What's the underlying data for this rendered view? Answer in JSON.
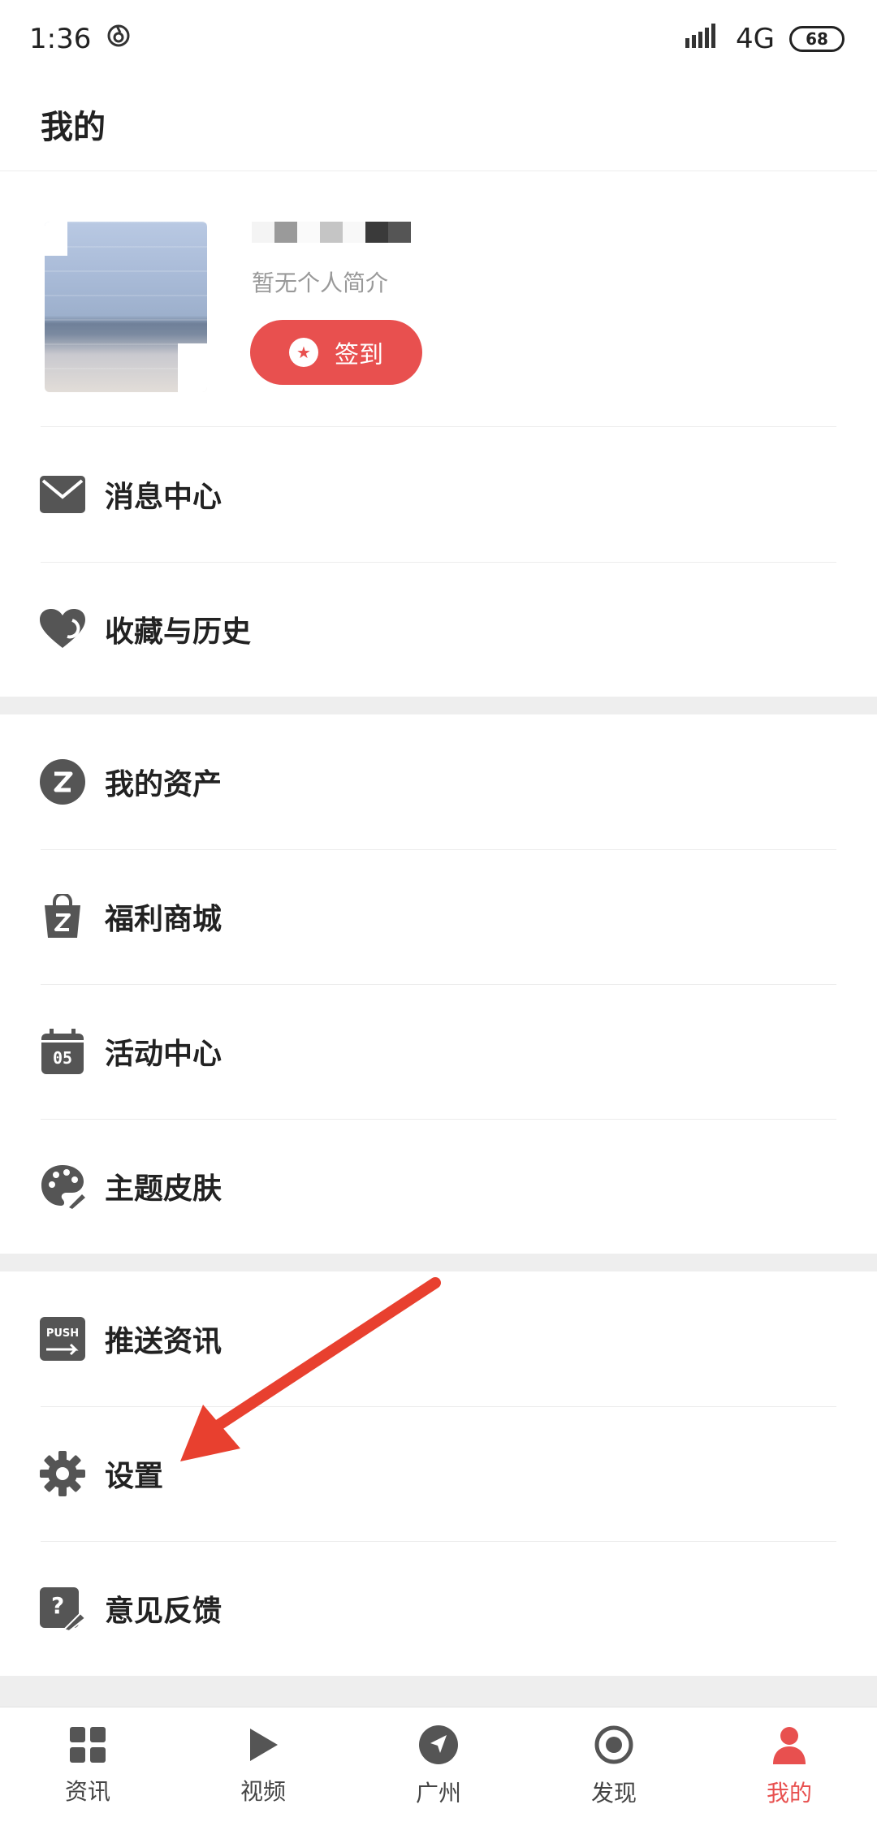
{
  "status": {
    "time": "1:36",
    "network": "4G",
    "battery": "68"
  },
  "header": {
    "title": "我的"
  },
  "profile": {
    "bio": "暂无个人简介",
    "checkin_label": "签到"
  },
  "menu": {
    "messages": "消息中心",
    "favorites": "收藏与历史",
    "assets": "我的资产",
    "mall": "福利商城",
    "events": "活动中心",
    "events_day": "05",
    "theme": "主题皮肤",
    "push": "推送资讯",
    "push_badge": "PUSH",
    "settings": "设置",
    "feedback": "意见反馈"
  },
  "tabs": {
    "news": "资讯",
    "video": "视频",
    "city": "广州",
    "discover": "发现",
    "mine": "我的"
  },
  "colors": {
    "accent": "#e8504f",
    "icon_gray": "#555555",
    "arrow": "#e8402f"
  }
}
